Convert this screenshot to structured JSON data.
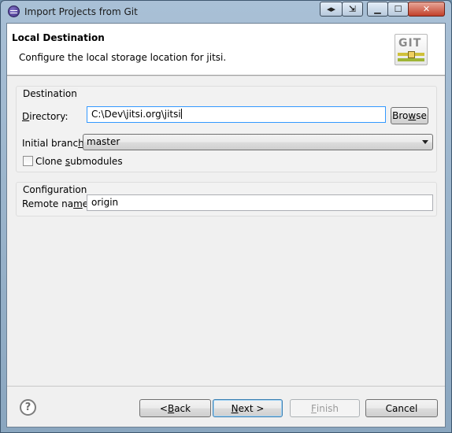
{
  "window": {
    "title": "Import Projects from Git",
    "controls": [
      "back-forth",
      "switch",
      "minimize",
      "maximize",
      "close"
    ]
  },
  "header": {
    "title": "Local Destination",
    "description": "Configure the local storage location for jitsi.",
    "icon_text": "GIT"
  },
  "destination": {
    "group_title": "Destination",
    "directory_label_u": "D",
    "directory_label_rest": "irectory:",
    "directory_value": "C:\\Dev\\jitsi.org\\jitsi",
    "browse_label_pre": "Bro",
    "browse_label_u": "w",
    "browse_label_post": "se",
    "initial_branch_label_pre": "Initial branc",
    "initial_branch_label_u": "h",
    "initial_branch_label_post": ":",
    "initial_branch_value": "master",
    "clone_submodules_label_pre": "Clone ",
    "clone_submodules_label_u": "s",
    "clone_submodules_label_post": "ubmodules",
    "clone_submodules_checked": false
  },
  "configuration": {
    "group_title": "Configuration",
    "remote_name_label_pre": "Remote na",
    "remote_name_label_u": "m",
    "remote_name_label_post": "e:",
    "remote_name_value": "origin"
  },
  "footer": {
    "help_glyph": "?",
    "back_pre": "< ",
    "back_u": "B",
    "back_post": "ack",
    "next_u": "N",
    "next_post": "ext >",
    "finish_u": "F",
    "finish_post": "inish",
    "cancel": "Cancel"
  }
}
